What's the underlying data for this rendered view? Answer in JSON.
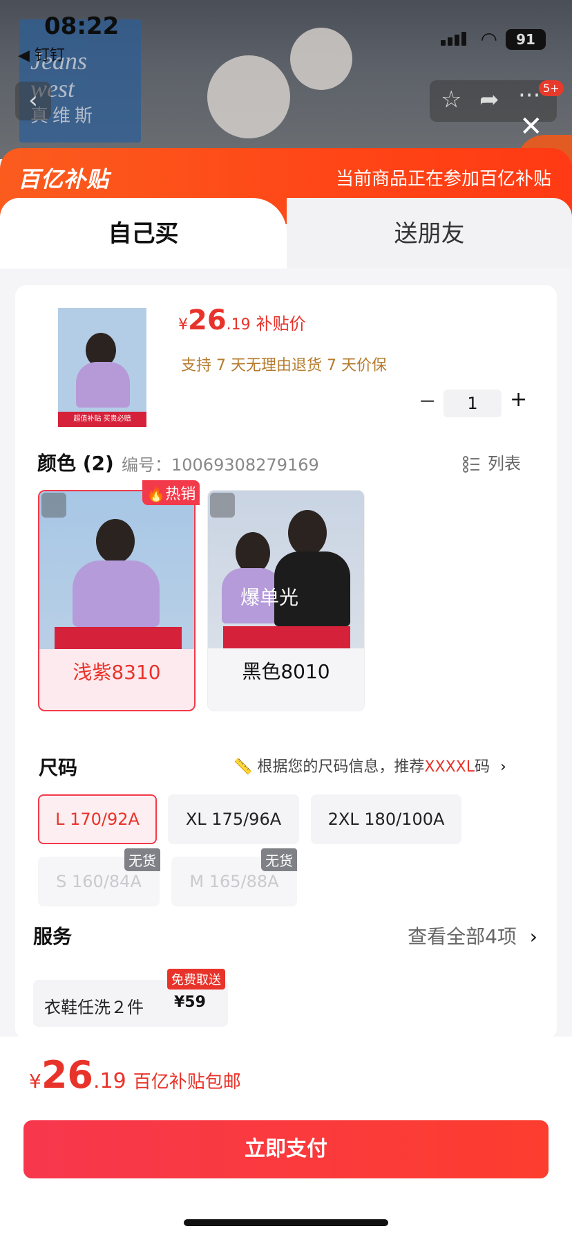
{
  "status_bar": {
    "time": "08:22",
    "back_app": "◀ 钉钉",
    "battery": "91"
  },
  "background": {
    "brand_text": "Jeans west",
    "brand_cn": "真维斯",
    "cart_badge": "5+"
  },
  "banner": {
    "logo": "百亿补贴",
    "message": "当前商品正在参加百亿补贴"
  },
  "tabs": [
    {
      "label": "自己买"
    },
    {
      "label": "送朋友"
    }
  ],
  "product": {
    "price_symbol": "¥",
    "price_int": "26",
    "price_dec": ".19",
    "price_label": "补贴价",
    "guarantee": "支持 7 天无理由退货   7 天价保",
    "quantity": "1",
    "thumb_caption": "超值补贴 买贵必赔"
  },
  "color": {
    "title": "颜色 (2)",
    "code": "编号：10069308279169",
    "list_label": "列表",
    "options": [
      {
        "label": "浅紫8310",
        "badge": "热销",
        "selected": true
      },
      {
        "label": "黑色8010",
        "overlay": "爆单光",
        "selected": false
      }
    ]
  },
  "size": {
    "title": "尺码",
    "rec_prefix": "根据您的尺码信息，推荐",
    "rec_value": "XXXXL",
    "rec_suffix": "码",
    "options": [
      {
        "label": "L 170/92A",
        "state": "selected"
      },
      {
        "label": "XL 175/96A",
        "state": "normal"
      },
      {
        "label": "2XL 180/100A",
        "state": "normal"
      },
      {
        "label": "S 160/84A",
        "state": "disabled",
        "badge": "无货"
      },
      {
        "label": "M 165/88A",
        "state": "disabled",
        "badge": "无货"
      }
    ]
  },
  "service": {
    "title": "服务",
    "view_all": "查看全部4项",
    "item_name": "衣鞋任洗２件",
    "item_price": "¥59",
    "item_tag": "免费取送"
  },
  "footer": {
    "price_symbol": "¥",
    "price_int": "26",
    "price_dec": ".19",
    "price_label": "百亿补贴包邮",
    "pay_label": "立即支付"
  },
  "colors": {
    "accent": "#e8332a",
    "banner": "#ff4516",
    "guarantee": "#b67a2d"
  }
}
